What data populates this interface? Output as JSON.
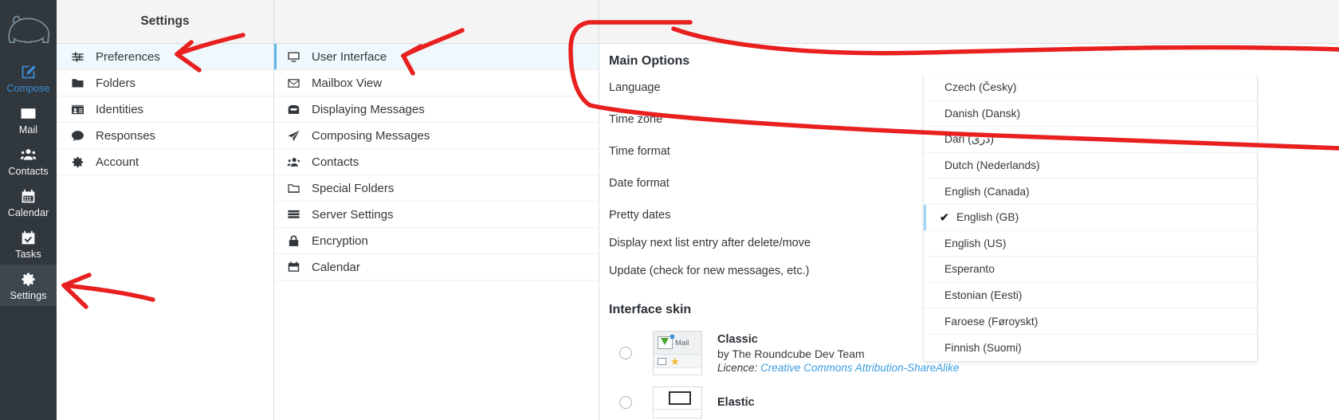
{
  "taskbar": {
    "logo_name": "roundcube-bear-logo",
    "items": [
      {
        "label": "Compose",
        "icon": "compose-icon",
        "state": "accent"
      },
      {
        "label": "Mail",
        "icon": "envelope-icon",
        "state": "normal"
      },
      {
        "label": "Contacts",
        "icon": "contacts-icon",
        "state": "normal"
      },
      {
        "label": "Calendar",
        "icon": "calendar-icon",
        "state": "normal"
      },
      {
        "label": "Tasks",
        "icon": "tasks-icon",
        "state": "normal"
      },
      {
        "label": "Settings",
        "icon": "gear-icon",
        "state": "selected"
      }
    ]
  },
  "settings_list": {
    "title": "Settings",
    "items": [
      {
        "label": "Preferences",
        "icon": "sliders-icon",
        "selected": true
      },
      {
        "label": "Folders",
        "icon": "folder-icon",
        "selected": false
      },
      {
        "label": "Identities",
        "icon": "id-card-icon",
        "selected": false
      },
      {
        "label": "Responses",
        "icon": "speech-bubble-icon",
        "selected": false
      },
      {
        "label": "Account",
        "icon": "gear-icon",
        "selected": false
      }
    ]
  },
  "sections_list": {
    "title": "",
    "items": [
      {
        "label": "User Interface",
        "icon": "monitor-icon",
        "selected": true
      },
      {
        "label": "Mailbox View",
        "icon": "envelope-icon",
        "selected": false
      },
      {
        "label": "Displaying Messages",
        "icon": "inbox-icon",
        "selected": false
      },
      {
        "label": "Composing Messages",
        "icon": "paper-plane-icon",
        "selected": false
      },
      {
        "label": "Contacts",
        "icon": "contacts-icon",
        "selected": false
      },
      {
        "label": "Special Folders",
        "icon": "folder-outline-icon",
        "selected": false
      },
      {
        "label": "Server Settings",
        "icon": "server-icon",
        "selected": false
      },
      {
        "label": "Encryption",
        "icon": "lock-icon",
        "selected": false
      },
      {
        "label": "Calendar",
        "icon": "calendar-icon",
        "selected": false
      }
    ]
  },
  "main": {
    "main_options_title": "Main Options",
    "options": [
      {
        "label": "Language"
      },
      {
        "label": "Time zone"
      },
      {
        "label": "Time format"
      },
      {
        "label": "Date format"
      },
      {
        "label": "Pretty dates"
      },
      {
        "label": "Display next list entry after delete/move"
      },
      {
        "label": "Update (check for new messages, etc.)"
      }
    ],
    "language_select": {
      "value": "English (GB)",
      "caret_icon": "chevron-up-down-icon",
      "open": true,
      "options": [
        "Czech (Česky)",
        "Danish (Dansk)",
        "Dari (دری)",
        "Dutch (Nederlands)",
        "English (Canada)",
        "English (GB)",
        "English (US)",
        "Esperanto",
        "Estonian (Eesti)",
        "Faroese (Føroyskt)",
        "Finnish (Suomi)"
      ],
      "selected_option": "English (GB)",
      "check_glyph": "✔"
    },
    "interface_skin_title": "Interface skin",
    "skins": [
      {
        "name": "Classic",
        "author": "by The Roundcube Dev Team",
        "licence_prefix": "Licence:",
        "licence_link": "Creative Commons Attribution-ShareAlike",
        "thumb_label": "Mail",
        "selected": false
      },
      {
        "name": "Elastic",
        "author": "",
        "licence_prefix": "",
        "licence_link": "",
        "thumb_label": "",
        "selected": false
      }
    ]
  },
  "annotations": {
    "color": "#e8201f",
    "note": "hand-drawn red arrows and circle highlighting Preferences, User Interface, Settings and the Language row"
  }
}
